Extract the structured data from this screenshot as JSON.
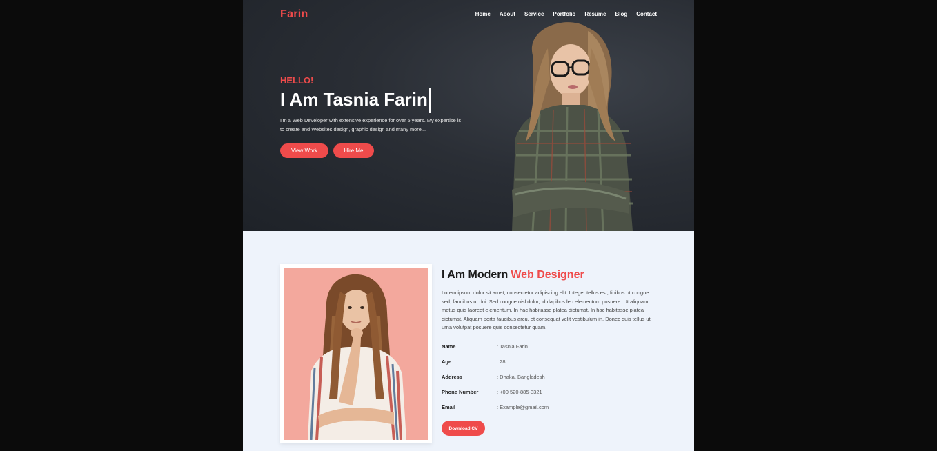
{
  "colors": {
    "accent": "#ef4b4b",
    "hero_bg": "#2a2e35",
    "about_bg": "#eef3fb"
  },
  "brand": {
    "logo": "Farin"
  },
  "nav": {
    "items": [
      "Home",
      "About",
      "Service",
      "Portfolio",
      "Resume",
      "Blog",
      "Contact"
    ]
  },
  "hero": {
    "greeting": "HELLO!",
    "headline": "I Am Tasnia Farin",
    "intro": "I'm a Web Developer with extensive experience for over 5 years. My expertise is to create and Websites design, graphic design and many more...",
    "view_work_label": "View Work",
    "hire_me_label": "Hire Me"
  },
  "about": {
    "title_prefix": "I Am Modern",
    "title_accent": "Web Designer",
    "text": "Lorem ipsum dolor sit amet, consectetur adipiscing elit. Integer tellus est, finibus ut congue sed, faucibus ut dui. Sed congue nisl dolor, id dapibus leo elementum posuere. Ut aliquam metus quis laoreet elementum. In hac habitasse platea dictumst. In hac habitasse platea dictumst. Aliquam porta faucibus arcu, et consequat velit vestibulum in. Donec quis tellus ut urna volutpat posuere quis consectetur quam.",
    "info": [
      {
        "label": "Name",
        "value": "Tasnia Farin"
      },
      {
        "label": "Age",
        "value": "28"
      },
      {
        "label": "Address",
        "value": "Dhaka, Bangladesh"
      },
      {
        "label": "Phone Number",
        "value": "+00 520-885-3321"
      },
      {
        "label": "Email",
        "value": "Example@gmail.com"
      }
    ],
    "download_label": "Download CV"
  }
}
